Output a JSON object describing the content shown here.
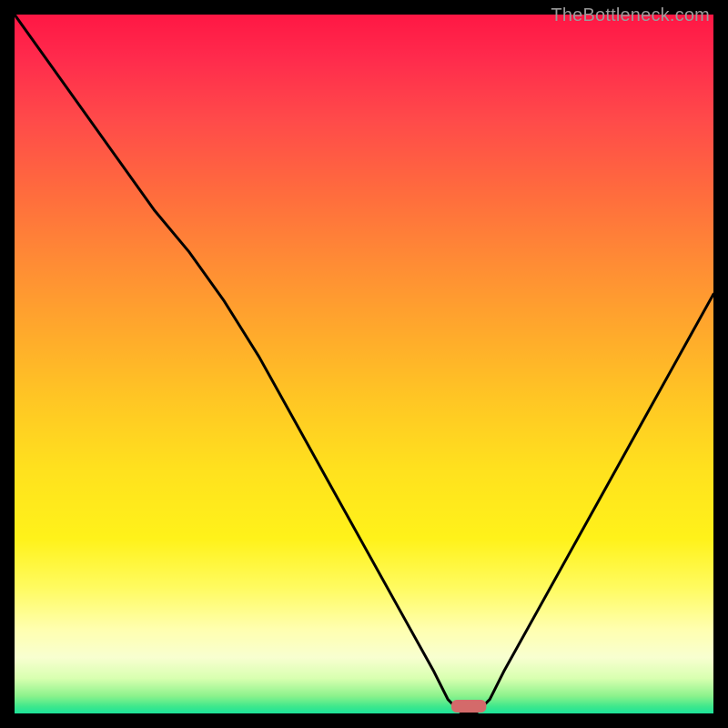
{
  "watermark": "TheBottleneck.com",
  "chart_data": {
    "type": "line",
    "title": "",
    "xlabel": "",
    "ylabel": "",
    "xlim": [
      0,
      100
    ],
    "ylim": [
      0,
      100
    ],
    "x": [
      0,
      5,
      10,
      15,
      20,
      25,
      30,
      35,
      40,
      45,
      50,
      55,
      60,
      62,
      64,
      66,
      68,
      70,
      75,
      80,
      85,
      90,
      95,
      100
    ],
    "values": [
      100,
      93,
      86,
      79,
      72,
      66,
      59,
      51,
      42,
      33,
      24,
      15,
      6,
      2,
      0,
      0,
      2,
      6,
      15,
      24,
      33,
      42,
      51,
      60
    ],
    "marker": {
      "x": 65,
      "y": 0,
      "width": 5,
      "height": 2,
      "color": "#d46a6a"
    },
    "gradient_bands": [
      {
        "stop": 0.0,
        "color": "#ff1744"
      },
      {
        "stop": 0.06,
        "color": "#ff2a4c"
      },
      {
        "stop": 0.15,
        "color": "#ff4a4a"
      },
      {
        "stop": 0.25,
        "color": "#ff6a3e"
      },
      {
        "stop": 0.35,
        "color": "#ff8a35"
      },
      {
        "stop": 0.45,
        "color": "#ffa82c"
      },
      {
        "stop": 0.55,
        "color": "#ffc624"
      },
      {
        "stop": 0.65,
        "color": "#ffe11e"
      },
      {
        "stop": 0.75,
        "color": "#fff21a"
      },
      {
        "stop": 0.82,
        "color": "#fffb60"
      },
      {
        "stop": 0.88,
        "color": "#ffffb0"
      },
      {
        "stop": 0.92,
        "color": "#f8ffd0"
      },
      {
        "stop": 0.95,
        "color": "#d8ffb0"
      },
      {
        "stop": 0.975,
        "color": "#8cf28c"
      },
      {
        "stop": 0.99,
        "color": "#3ee88c"
      },
      {
        "stop": 1.0,
        "color": "#1de39a"
      }
    ]
  }
}
